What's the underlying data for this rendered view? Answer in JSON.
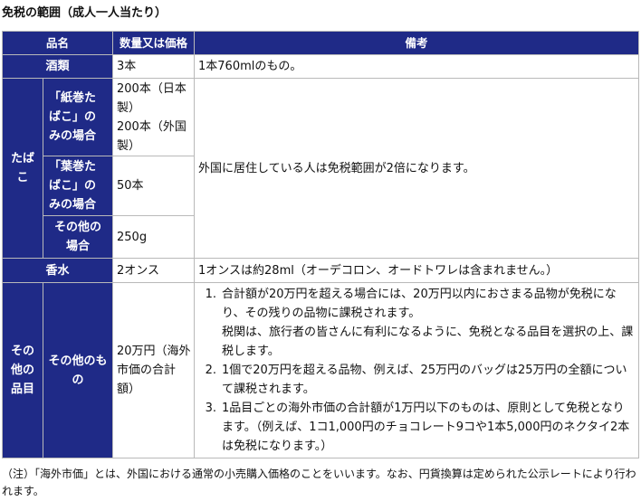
{
  "title": "免税の範囲（成人一人当たり）",
  "headers": {
    "item": "品名",
    "quantity": "数量又は価格",
    "remarks": "備考"
  },
  "alcohol": {
    "label": "酒類",
    "quantity": "3本",
    "remark": "1本760mlのもの。"
  },
  "tobacco": {
    "label": "たばこ",
    "shared_remark": "外国に居住している人は免税範囲が2倍になります。",
    "cigarettes": {
      "label": "「紙巻たばこ」のみの場合",
      "quantity_jp": "200本（日本製）",
      "quantity_foreign": "200本（外国製）"
    },
    "cigars": {
      "label": "「葉巻たばこ」のみの場合",
      "quantity": "50本"
    },
    "other": {
      "label": "その他の場合",
      "quantity": "250g"
    }
  },
  "perfume": {
    "label": "香水",
    "quantity": "2オンス",
    "remark": "1オンスは約28ml（オーデコロン、オードトワレは含まれません。）"
  },
  "other_items": {
    "label": "その他の品目",
    "sub_label": "その他のもの",
    "quantity": "20万円（海外市価の合計額）",
    "notes": [
      {
        "num": "1.",
        "text": "合計額が20万円を超える場合には、20万円以内におさまる品物が免税になり、その残りの品物に課税されます。",
        "sub": "税関は、旅行者の皆さんに有利になるように、免税となる品目を選択の上、課税します。"
      },
      {
        "num": "2.",
        "text": "1個で20万円を超える品物、例えば、25万円のバッグは25万円の全額について課税されます。"
      },
      {
        "num": "3.",
        "text": "1品目ごとの海外市価の合計額が1万円以下のものは、原則として免税となります。（例えば、1コ1,000円のチョコレート9コや1本5,000円のネクタイ2本は免税になります。）"
      }
    ]
  },
  "footnote": "（注）「海外市価」とは、外国における通常の小売購入価格のことをいいます。なお、円貨換算は定められた公示レートにより行われます。",
  "colors": {
    "header_bg": "#1f2a87",
    "header_text": "#ffffff",
    "border": "#b9b9b9"
  }
}
